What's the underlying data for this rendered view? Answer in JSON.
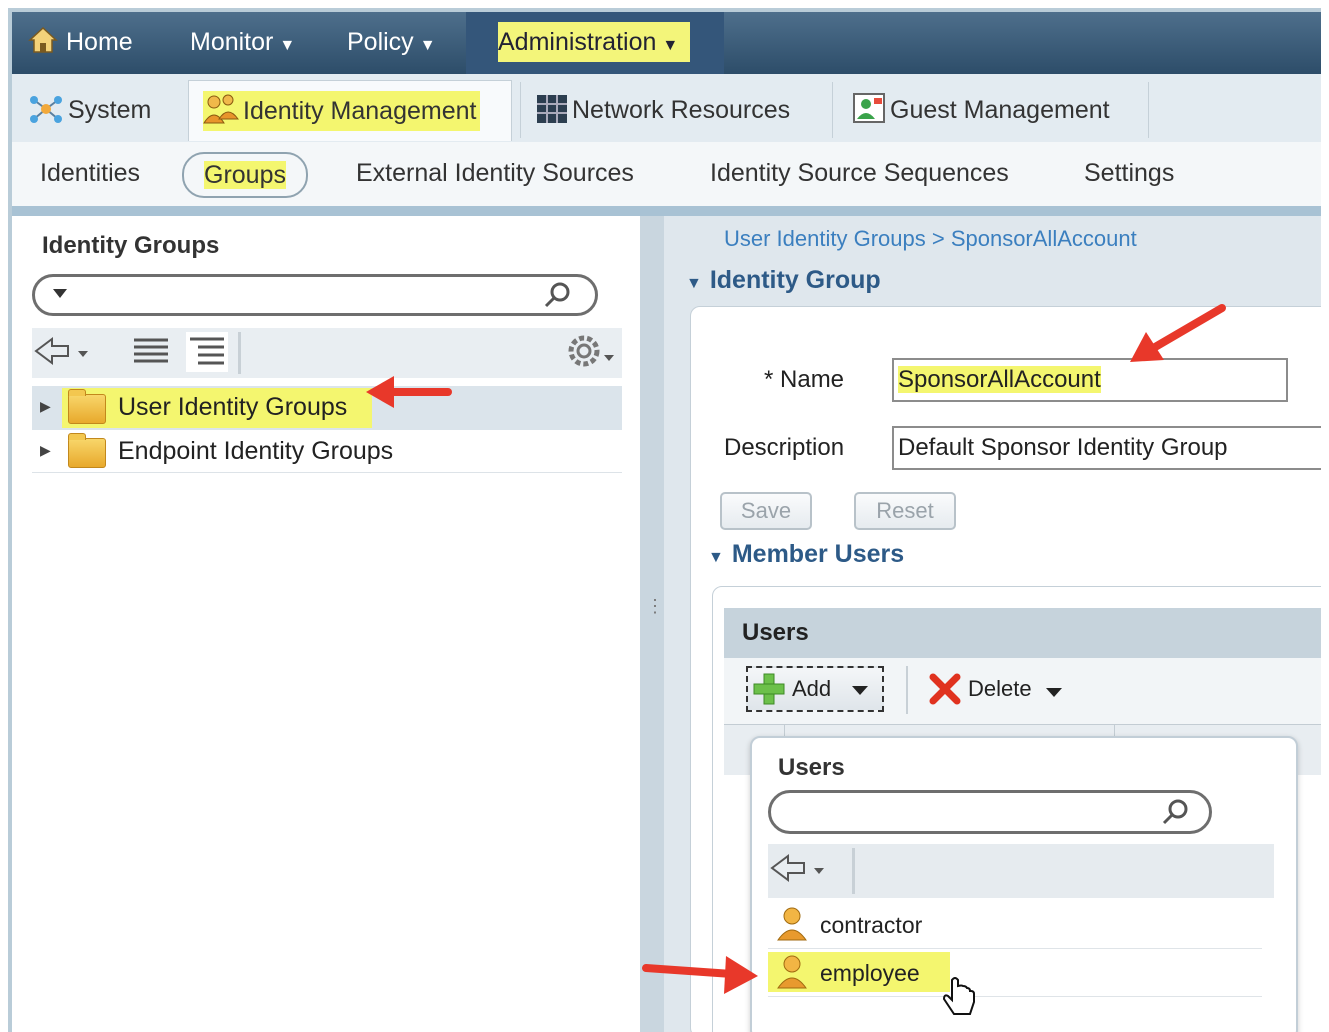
{
  "top_nav": {
    "home": "Home",
    "monitor": "Monitor",
    "policy": "Policy",
    "administration": "Administration",
    "caret": "▼"
  },
  "tabs": {
    "system": "System",
    "identity_management": "Identity Management",
    "network_resources": "Network Resources",
    "guest_management": "Guest Management"
  },
  "subtabs": {
    "identities": "Identities",
    "groups": "Groups",
    "external_identity_sources": "External Identity Sources",
    "identity_source_sequences": "Identity Source Sequences",
    "settings": "Settings"
  },
  "left_panel": {
    "title": "Identity Groups",
    "tree": [
      {
        "label": "User Identity Groups",
        "selected": true
      },
      {
        "label": "Endpoint Identity Groups",
        "selected": false
      }
    ]
  },
  "right_panel": {
    "breadcrumb": "User Identity Groups > SponsorAllAccount",
    "section_identity_group": "Identity Group",
    "name_label": "* Name",
    "name_value": "SponsorAllAccount",
    "description_label": "Description",
    "description_value": "Default Sponsor Identity Group",
    "save": "Save",
    "reset": "Reset",
    "section_member_users": "Member Users",
    "users_table_title": "Users",
    "add": "Add",
    "delete": "Delete"
  },
  "popup": {
    "title": "Users",
    "users": [
      "contractor",
      "employee"
    ]
  },
  "colors": {
    "highlight": "#f4f66f",
    "annotation_arrow": "#e8382a",
    "link_blue": "#3b7fbf"
  }
}
